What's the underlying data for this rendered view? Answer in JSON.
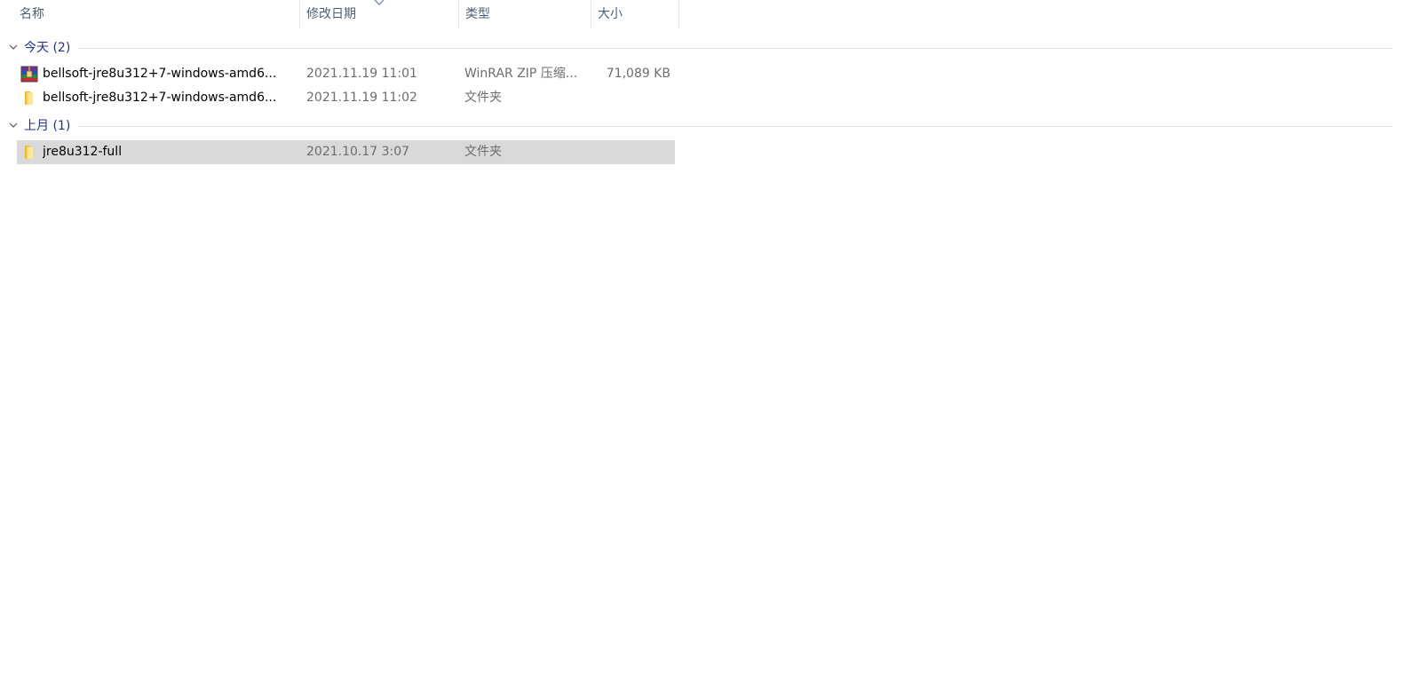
{
  "columns": {
    "name": "名称",
    "date": "修改日期",
    "type": "类型",
    "size": "大小"
  },
  "groups": [
    {
      "label": "今天 (2)",
      "items": [
        {
          "name": "bellsoft-jre8u312+7-windows-amd6...",
          "date": "2021.11.19 11:01",
          "type": "WinRAR ZIP 压缩...",
          "size": "71,089 KB",
          "icon": "winrar-archive-icon"
        },
        {
          "name": "bellsoft-jre8u312+7-windows-amd6...",
          "date": "2021.11.19 11:02",
          "type": "文件夹",
          "size": "",
          "icon": "folder-icon"
        }
      ]
    },
    {
      "label": "上月 (1)",
      "items": [
        {
          "name": "jre8u312-full",
          "date": "2021.10.17 3:07",
          "type": "文件夹",
          "size": "",
          "icon": "folder-icon",
          "selected": true
        }
      ]
    }
  ],
  "colors": {
    "header_text": "#4c607a",
    "group_text": "#1e3287",
    "selection": "#d9d9d9",
    "meta_text": "#6d6d6d"
  }
}
